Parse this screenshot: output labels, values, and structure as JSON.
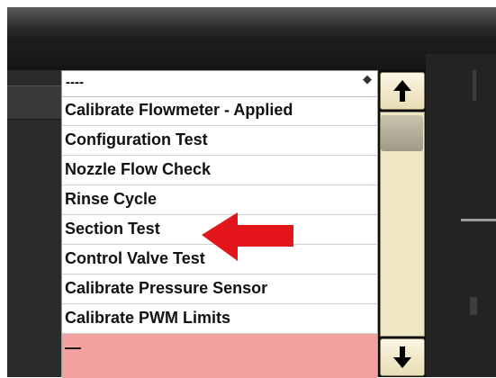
{
  "dropdown": {
    "selected_value": "----",
    "items": [
      "Calibrate Flowmeter - Applied",
      "Configuration Test",
      "Nozzle Flow Check",
      "Rinse Cycle",
      "Section Test",
      "Control Valve Test",
      "Calibrate Pressure Sensor",
      "Calibrate PWM Limits",
      "—"
    ]
  },
  "scrollbar": {
    "up_icon": "up-arrow-icon",
    "down_icon": "down-arrow-icon"
  },
  "colors": {
    "highlight_row": "#f2a0a0",
    "annotation_arrow": "#e3161b",
    "scroll_track": "#efe6c4"
  }
}
